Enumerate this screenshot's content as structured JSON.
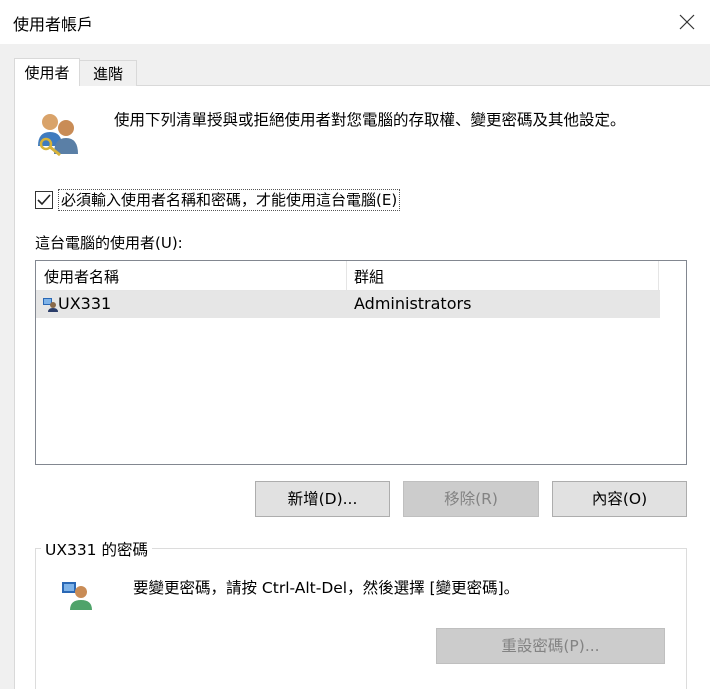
{
  "window": {
    "title": "使用者帳戶"
  },
  "tabs": [
    {
      "label": "使用者",
      "active": true
    },
    {
      "label": "進階",
      "active": false
    }
  ],
  "description": "使用下列清單授與或拒絕使用者對您電腦的存取權、變更密碼及其他設定。",
  "require_login": {
    "label": "必須輸入使用者名稱和密碼，才能使用這台電腦(E)",
    "checked": true
  },
  "users_label": "這台電腦的使用者(U):",
  "user_list": {
    "columns": [
      "使用者名稱",
      "群組"
    ],
    "rows": [
      {
        "name": "UX331",
        "group": "Administrators"
      }
    ]
  },
  "buttons": {
    "add": "新增(D)...",
    "remove": "移除(R)",
    "properties": "內容(O)"
  },
  "password_group": {
    "title": "UX331 的密碼",
    "text": "要變更密碼，請按 Ctrl-Alt-Del，然後選擇 [變更密碼]。",
    "reset_button": "重設密碼(P)..."
  },
  "colors": {
    "accent_blue": "#1e6fc4",
    "selected_row": "#e6e6e6"
  }
}
